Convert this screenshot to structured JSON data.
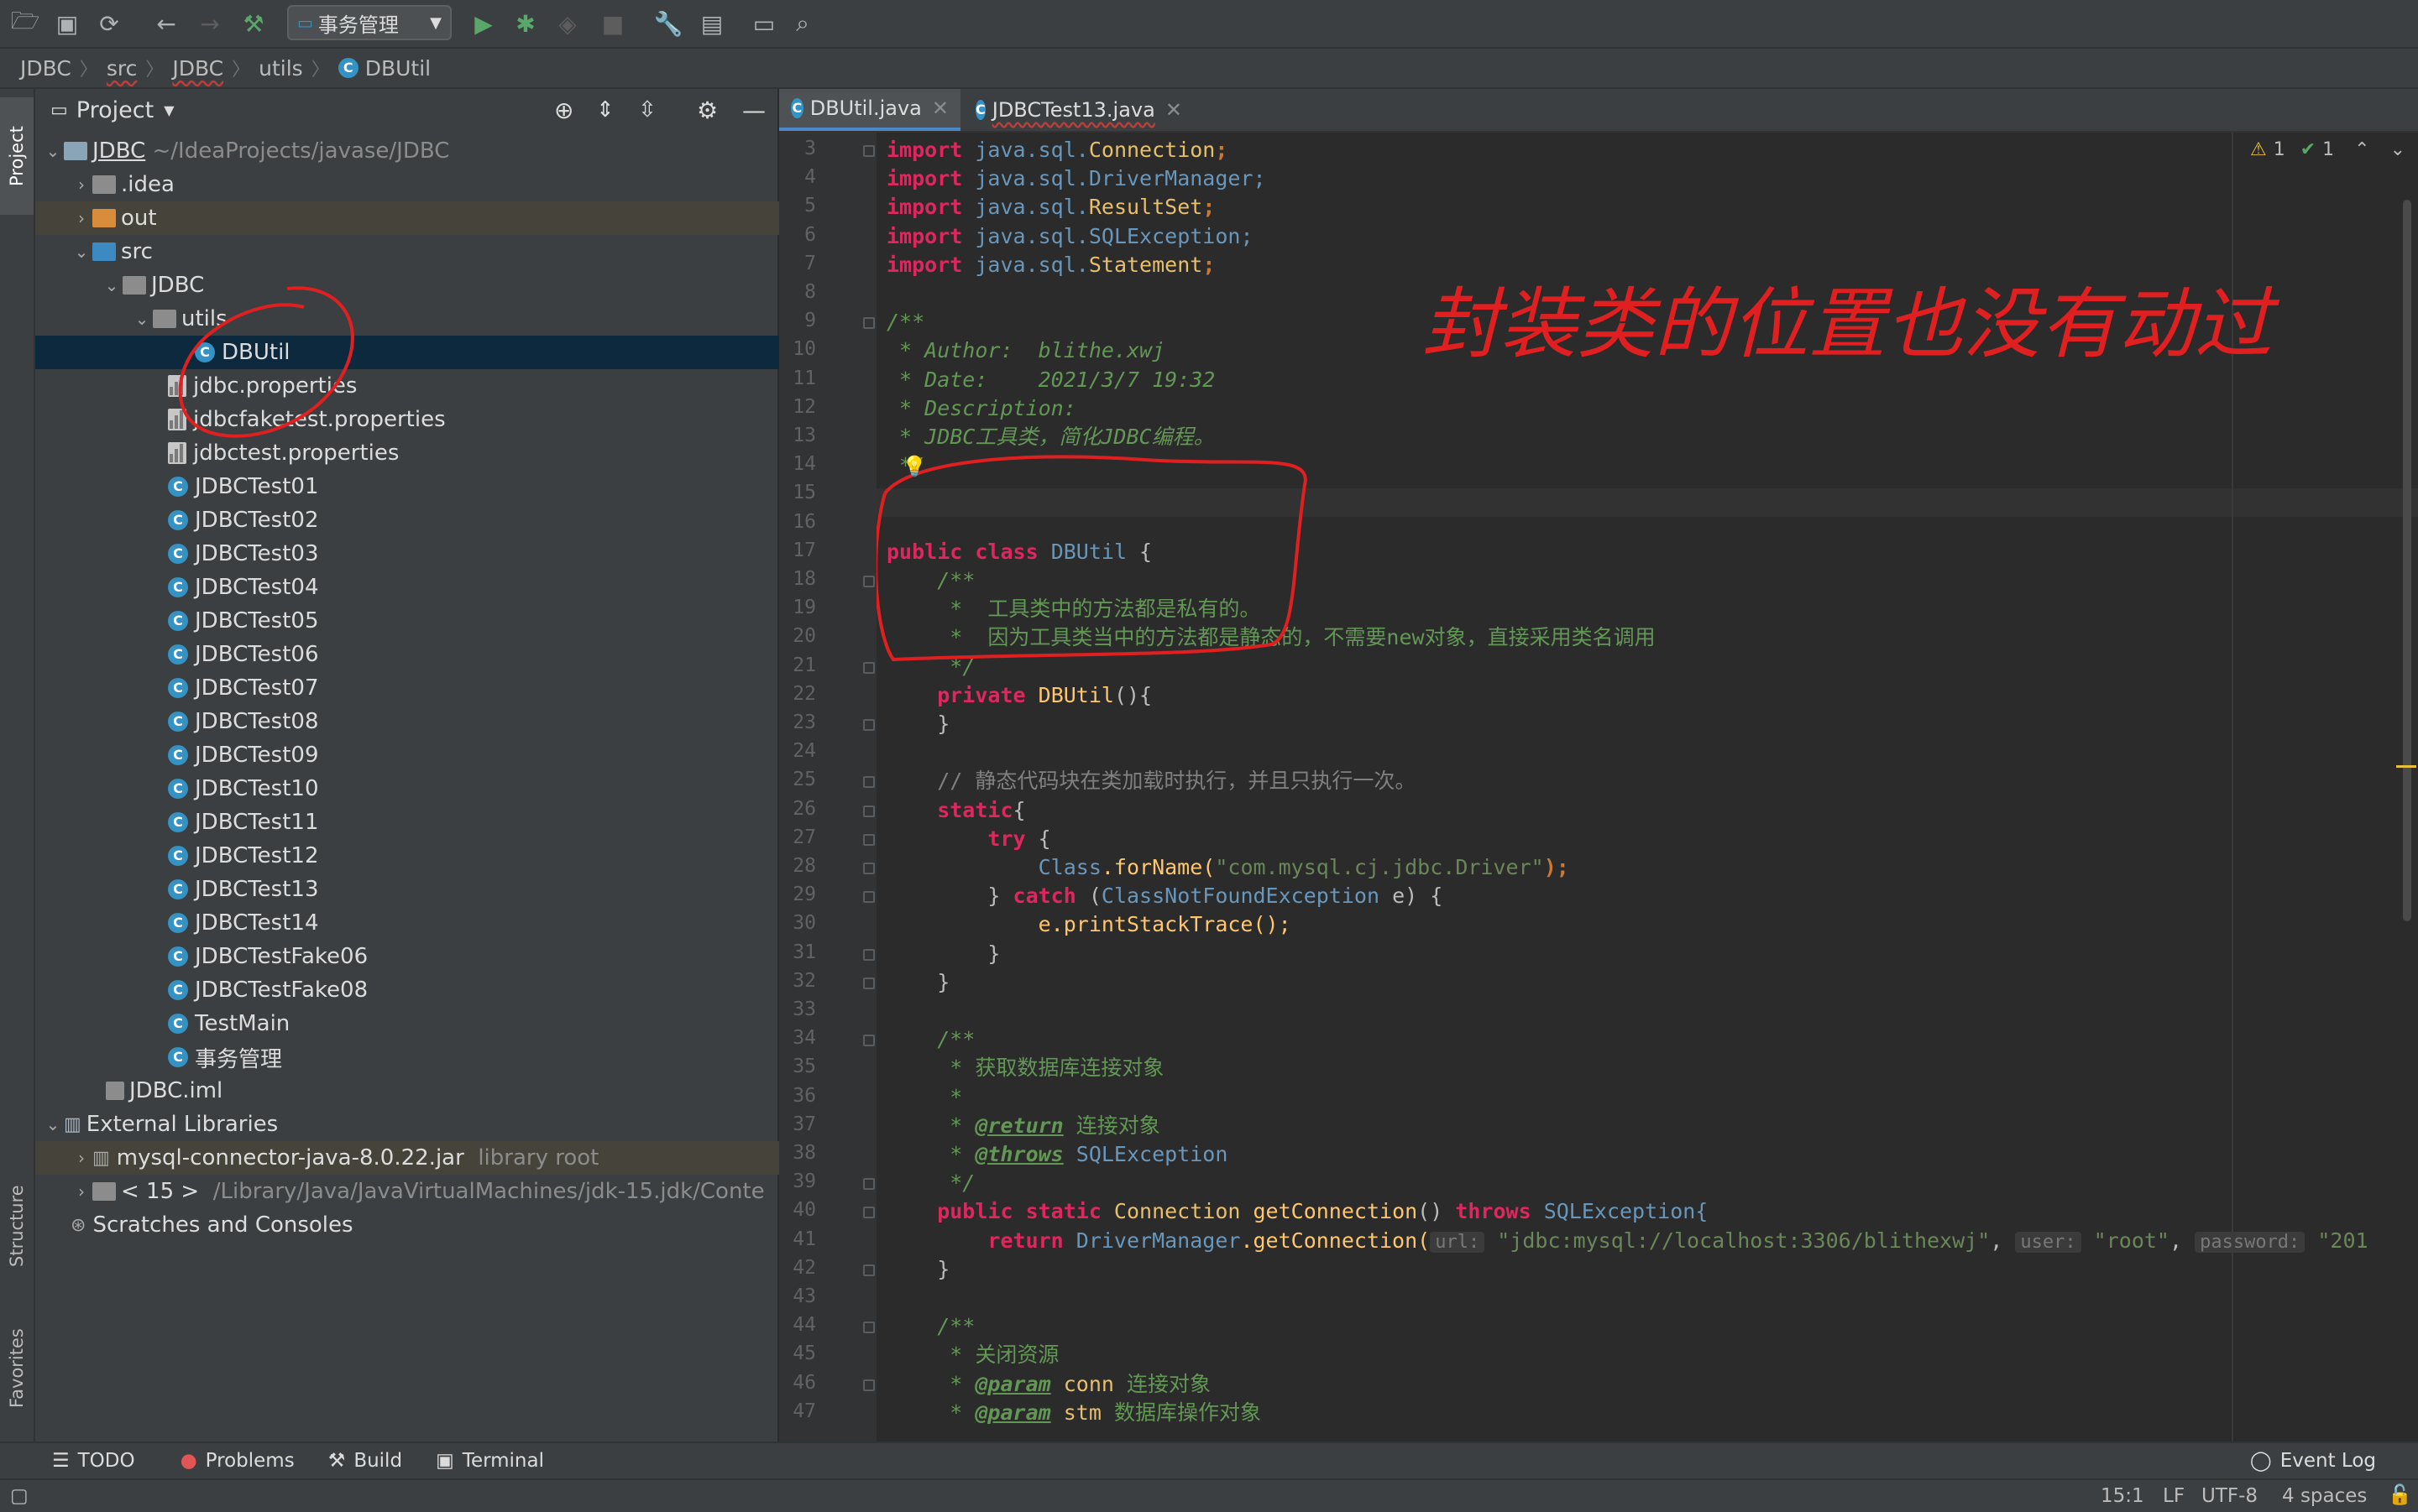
{
  "toolbar": {
    "run_config": "事务管理"
  },
  "breadcrumb": [
    "JDBC",
    "src",
    "JDBC",
    "utils",
    "DBUtil"
  ],
  "side_tabs": {
    "project": "Project",
    "structure": "Structure",
    "favorites": "Favorites"
  },
  "project_panel": {
    "title": "Project",
    "tree": [
      {
        "label": "JDBC",
        "extra": "~/IdeaProjects/javase/JDBC"
      },
      {
        "label": ".idea"
      },
      {
        "label": "out"
      },
      {
        "label": "src"
      },
      {
        "label": "JDBC"
      },
      {
        "label": "utils"
      },
      {
        "label": "DBUtil"
      },
      {
        "label": "jdbc.properties"
      },
      {
        "label": "jdbcfaketest.properties"
      },
      {
        "label": "jdbctest.properties"
      },
      {
        "label": "JDBCTest01"
      },
      {
        "label": "JDBCTest02"
      },
      {
        "label": "JDBCTest03"
      },
      {
        "label": "JDBCTest04"
      },
      {
        "label": "JDBCTest05"
      },
      {
        "label": "JDBCTest06"
      },
      {
        "label": "JDBCTest07"
      },
      {
        "label": "JDBCTest08"
      },
      {
        "label": "JDBCTest09"
      },
      {
        "label": "JDBCTest10"
      },
      {
        "label": "JDBCTest11"
      },
      {
        "label": "JDBCTest12"
      },
      {
        "label": "JDBCTest13"
      },
      {
        "label": "JDBCTest14"
      },
      {
        "label": "JDBCTestFake06"
      },
      {
        "label": "JDBCTestFake08"
      },
      {
        "label": "TestMain"
      },
      {
        "label": "事务管理"
      },
      {
        "label": "JDBC.iml"
      },
      {
        "label": "External Libraries"
      },
      {
        "label": "mysql-connector-java-8.0.22.jar",
        "extra": "library root"
      },
      {
        "label": "< 15 >",
        "extra": "/Library/Java/JavaVirtualMachines/jdk-15.jdk/Conte"
      },
      {
        "label": "Scratches and Consoles"
      }
    ]
  },
  "editor": {
    "tabs": [
      "DBUtil.java",
      "JDBCTest13.java"
    ],
    "inspections": {
      "warnings": "1",
      "checks": "1"
    },
    "line_numbers": [
      "3",
      "4",
      "5",
      "6",
      "7",
      "8",
      "9",
      "10",
      "11",
      "12",
      "13",
      "14",
      "15",
      "16",
      "17",
      "18",
      "19",
      "20",
      "21",
      "22",
      "23",
      "24",
      "25",
      "26",
      "27",
      "28",
      "29",
      "30",
      "31",
      "32",
      "33",
      "34",
      "35",
      "36",
      "37",
      "38",
      "39",
      "40",
      "41",
      "42",
      "43",
      "44",
      "45",
      "46",
      "47"
    ],
    "code": {
      "l3a": "import",
      "l3b": "java.sql.",
      "l3c": "Connection",
      "l3d": ";",
      "l4a": "import",
      "l4b": "java.sql.DriverManager;",
      "l5a": "import",
      "l5b": "java.sql.",
      "l5c": "ResultSet",
      "l5d": ";",
      "l6a": "import",
      "l6b": "java.sql.SQLException;",
      "l7a": "import",
      "l7b": "java.sql.",
      "l7c": "Statement",
      "l7d": ";",
      "l9": "/**",
      "l10": " * Author:  blithe.xwj",
      "l11": " * Date:    2021/3/7 19:32",
      "l12": " * Description:",
      "l13": " * JDBC工具类，简化JDBC编程。",
      "l14": " */",
      "l17a": "public class",
      "l17b": "DBUtil",
      "l17c": " {",
      "l18": "    /**",
      "l19": "     *  工具类中的方法都是私有的。",
      "l20": "     *  因为工具类当中的方法都是静态的，不需要new对象，直接采用类名调用",
      "l21": "     */",
      "l22a": "    private",
      "l22b": "DBUtil",
      "l22c": "(){",
      "l23": "    }",
      "l25": "    // 静态代码块在类加载时执行，并且只执行一次。",
      "l26a": "    static",
      "l26b": "{",
      "l27a": "        try",
      "l27b": " {",
      "l28a": "            Class",
      "l28b": ".forName(",
      "l28c": "\"com.mysql.cj.jdbc.Driver\"",
      "l28d": ");",
      "l29a": "        } ",
      "l29b": "catch",
      "l29c": " (",
      "l29d": "ClassNotFoundException",
      "l29e": " e) {",
      "l30": "            e.printStackTrace();",
      "l31": "        }",
      "l32": "    }",
      "l34": "    /**",
      "l35": "     * 获取数据库连接对象",
      "l36": "     *",
      "l37a": "     * ",
      "l37b": "@return",
      "l37c": " 连接对象",
      "l38a": "     * ",
      "l38b": "@throws",
      "l38c": " SQLException",
      "l39": "     */",
      "l40a": "    public static",
      "l40b": " Connection ",
      "l40c": "getConnection",
      "l40d": "() ",
      "l40e": "throws",
      "l40f": " SQLException{",
      "l41a": "        return",
      "l41b": " DriverManager",
      "l41c": ".getConnection(",
      "l41h1": "url:",
      "l41s1": "\"jdbc:mysql://localhost:3306/blithexwj\"",
      "l41h2": "user:",
      "l41s2": "\"root\"",
      "l41h3": "password:",
      "l41s3": "\"201",
      "l42": "    }",
      "l44": "    /**",
      "l45": "     * 关闭资源",
      "l46a": "     * ",
      "l46b": "@param",
      "l46c": " conn ",
      "l46d": "连接对象",
      "l47a": "     * ",
      "l47b": "@param",
      "l47c": " stm ",
      "l47d": "数据库操作对象"
    },
    "annotation": "封装类的位置也没有动过"
  },
  "bottom_tools": [
    "TODO",
    "Problems",
    "Build",
    "Terminal",
    "Event Log"
  ],
  "status": {
    "position": "15:1",
    "line_sep": "LF",
    "encoding": "UTF-8",
    "indent": "4 spaces"
  }
}
